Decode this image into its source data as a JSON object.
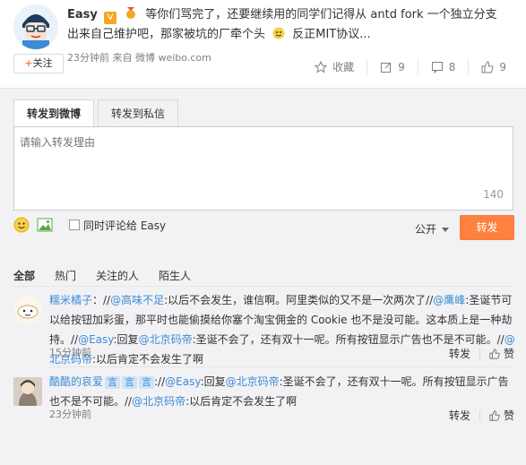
{
  "post": {
    "author": "Easy",
    "vip_mark": "V",
    "text_line1": "等你们骂完了，还要继续用的同学们记得从 antd fork 一个独立分支",
    "text_line2": "出来自己维护吧，那家被坑的厂牵个头",
    "text_line2_end": "反正MIT协议...",
    "follow_label": "关注",
    "meta": "23分钟前 来自 微博 weibo.com",
    "actions": [
      {
        "icon": "star-icon",
        "label": "收藏"
      },
      {
        "icon": "edit-icon",
        "label": "9"
      },
      {
        "icon": "comment-icon",
        "label": "8"
      },
      {
        "icon": "like-icon",
        "label": "9"
      }
    ]
  },
  "forward": {
    "tabs": [
      "转发到微博",
      "转发到私信"
    ],
    "placeholder": "请输入转发理由",
    "count": "140",
    "sync_comment_label": "同时评论给 Easy",
    "visibility": "公开",
    "submit_label": "转发"
  },
  "filters": [
    "全部",
    "热门",
    "关注的人",
    "陌生人"
  ],
  "comments": [
    {
      "name": "糯米橘子",
      "segments": [
        {
          "t": "：//",
          "k": "text"
        },
        {
          "t": "@高味不足",
          "k": "link"
        },
        {
          "t": ":以后不会发生，谁信啊。阿里类似的又不是一次两次了//",
          "k": "text"
        },
        {
          "t": "@鹰峰",
          "k": "link"
        },
        {
          "t": ":圣诞节可以给按钮加彩蛋，那平时也能偷摸给你塞个淘宝佣金的 Cookie 也不是没可能。这本质上是一种劫持。//",
          "k": "text"
        },
        {
          "t": "@Easy",
          "k": "link"
        },
        {
          "t": ":回复",
          "k": "text"
        },
        {
          "t": "@北京码帝",
          "k": "link"
        },
        {
          "t": ":圣诞不会了，还有双十一呢。所有按钮显示广告也不是不可能。//",
          "k": "text"
        },
        {
          "t": "@北京码帝",
          "k": "link"
        },
        {
          "t": ":以后肯定不会发生了啊",
          "k": "text"
        }
      ],
      "time": "15分钟前",
      "forward_label": "转发",
      "like_label": "赞"
    },
    {
      "name": "酷酷的哀爱",
      "badges": [
        "言",
        "言",
        "言"
      ],
      "segments": [
        {
          "t": "://",
          "k": "text"
        },
        {
          "t": "@Easy",
          "k": "link"
        },
        {
          "t": ":回复",
          "k": "text"
        },
        {
          "t": "@北京码帝",
          "k": "link"
        },
        {
          "t": ":圣诞不会了，还有双十一呢。所有按钮显示广告也不是不可能。//",
          "k": "text"
        },
        {
          "t": "@北京码帝",
          "k": "link"
        },
        {
          "t": ":以后肯定不会发生了啊",
          "k": "text"
        }
      ],
      "time": "23分钟前",
      "forward_label": "转发",
      "like_label": "赞"
    }
  ],
  "colors": {
    "link": "#3b8bd5",
    "accent": "#ff8140",
    "panel_bg": "#f2f2f5"
  }
}
